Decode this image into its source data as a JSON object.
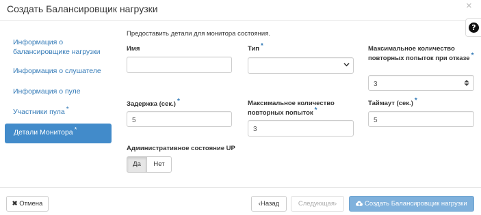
{
  "modal": {
    "title": "Создать Балансировщик нагрузки",
    "close_icon": "×",
    "help_icon": "?"
  },
  "sidebar": {
    "items": [
      {
        "label": "Информация о балансировщике нагрузки",
        "required": false,
        "active": false
      },
      {
        "label": "Информация о слушателе",
        "required": false,
        "active": false
      },
      {
        "label": "Информация о пуле",
        "required": false,
        "active": false
      },
      {
        "label": "Участники пула",
        "required": true,
        "active": false
      },
      {
        "label": "Детали Монитора",
        "required": true,
        "active": true
      }
    ],
    "required_mark": "*"
  },
  "form": {
    "description": "Предоставить детали для монитора состояния.",
    "name": {
      "label": "Имя",
      "value": ""
    },
    "type": {
      "label": "Тип",
      "value": "",
      "required": true
    },
    "max_retries_down": {
      "label": "Максимальное количество повторных попыток при отказе",
      "value": "3",
      "required": true
    },
    "delay": {
      "label": "Задержка (сек.)",
      "value": "5",
      "required": true
    },
    "max_retries": {
      "label": "Максимальное количество повторных попыток",
      "value": "3",
      "required": true
    },
    "timeout": {
      "label": "Таймаут (сек.)",
      "value": "5",
      "required": true
    },
    "admin_state": {
      "label": "Административное состояние UP",
      "yes": "Да",
      "no": "Нет",
      "selected": "Да"
    }
  },
  "footer": {
    "cancel": "Отмена",
    "back": "Назад",
    "next": "Следующая",
    "create": "Создать Балансировщик нагрузки"
  },
  "colors": {
    "accent": "#428bca",
    "link": "#337ab7",
    "primary_disabled": "#7fb1dc"
  }
}
